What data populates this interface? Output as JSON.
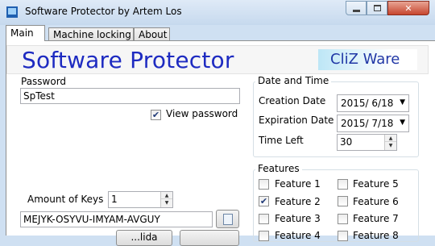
{
  "window": {
    "title": "Software Protector by Artem Los"
  },
  "tabs": [
    {
      "label": "Main",
      "active": true
    },
    {
      "label": "Machine locking",
      "active": false
    },
    {
      "label": "About",
      "active": false
    }
  ],
  "banner": {
    "title": "Software Protector",
    "logo": "CliZ Ware"
  },
  "password": {
    "label": "Password",
    "value": "SpTest",
    "view_label": "View password",
    "view_checked": true
  },
  "keys": {
    "amount_label": "Amount of Keys",
    "amount_value": "1",
    "generated_key": "MEJYK-OSYVU-IMYAM-AVGUY"
  },
  "bottom_buttons": [
    "...lida",
    ""
  ],
  "date_time": {
    "title": "Date and Time",
    "creation_label": "Creation Date",
    "creation_value": "2015/  6/18",
    "expiration_label": "Expiration Date",
    "expiration_value": "2015/  7/18",
    "time_left_label": "Time Left",
    "time_left_value": "30"
  },
  "features": {
    "title": "Features",
    "items": [
      {
        "label": "Feature 1",
        "checked": false
      },
      {
        "label": "Feature 2",
        "checked": true
      },
      {
        "label": "Feature 3",
        "checked": false
      },
      {
        "label": "Feature 4",
        "checked": false
      },
      {
        "label": "Feature 5",
        "checked": false
      },
      {
        "label": "Feature 6",
        "checked": false
      },
      {
        "label": "Feature 7",
        "checked": false
      },
      {
        "label": "Feature 8",
        "checked": false
      }
    ]
  },
  "colors": {
    "banner_title": "#1e2bc1",
    "logo_text": "#2138a6",
    "window_frame": "#cfe0f2"
  }
}
